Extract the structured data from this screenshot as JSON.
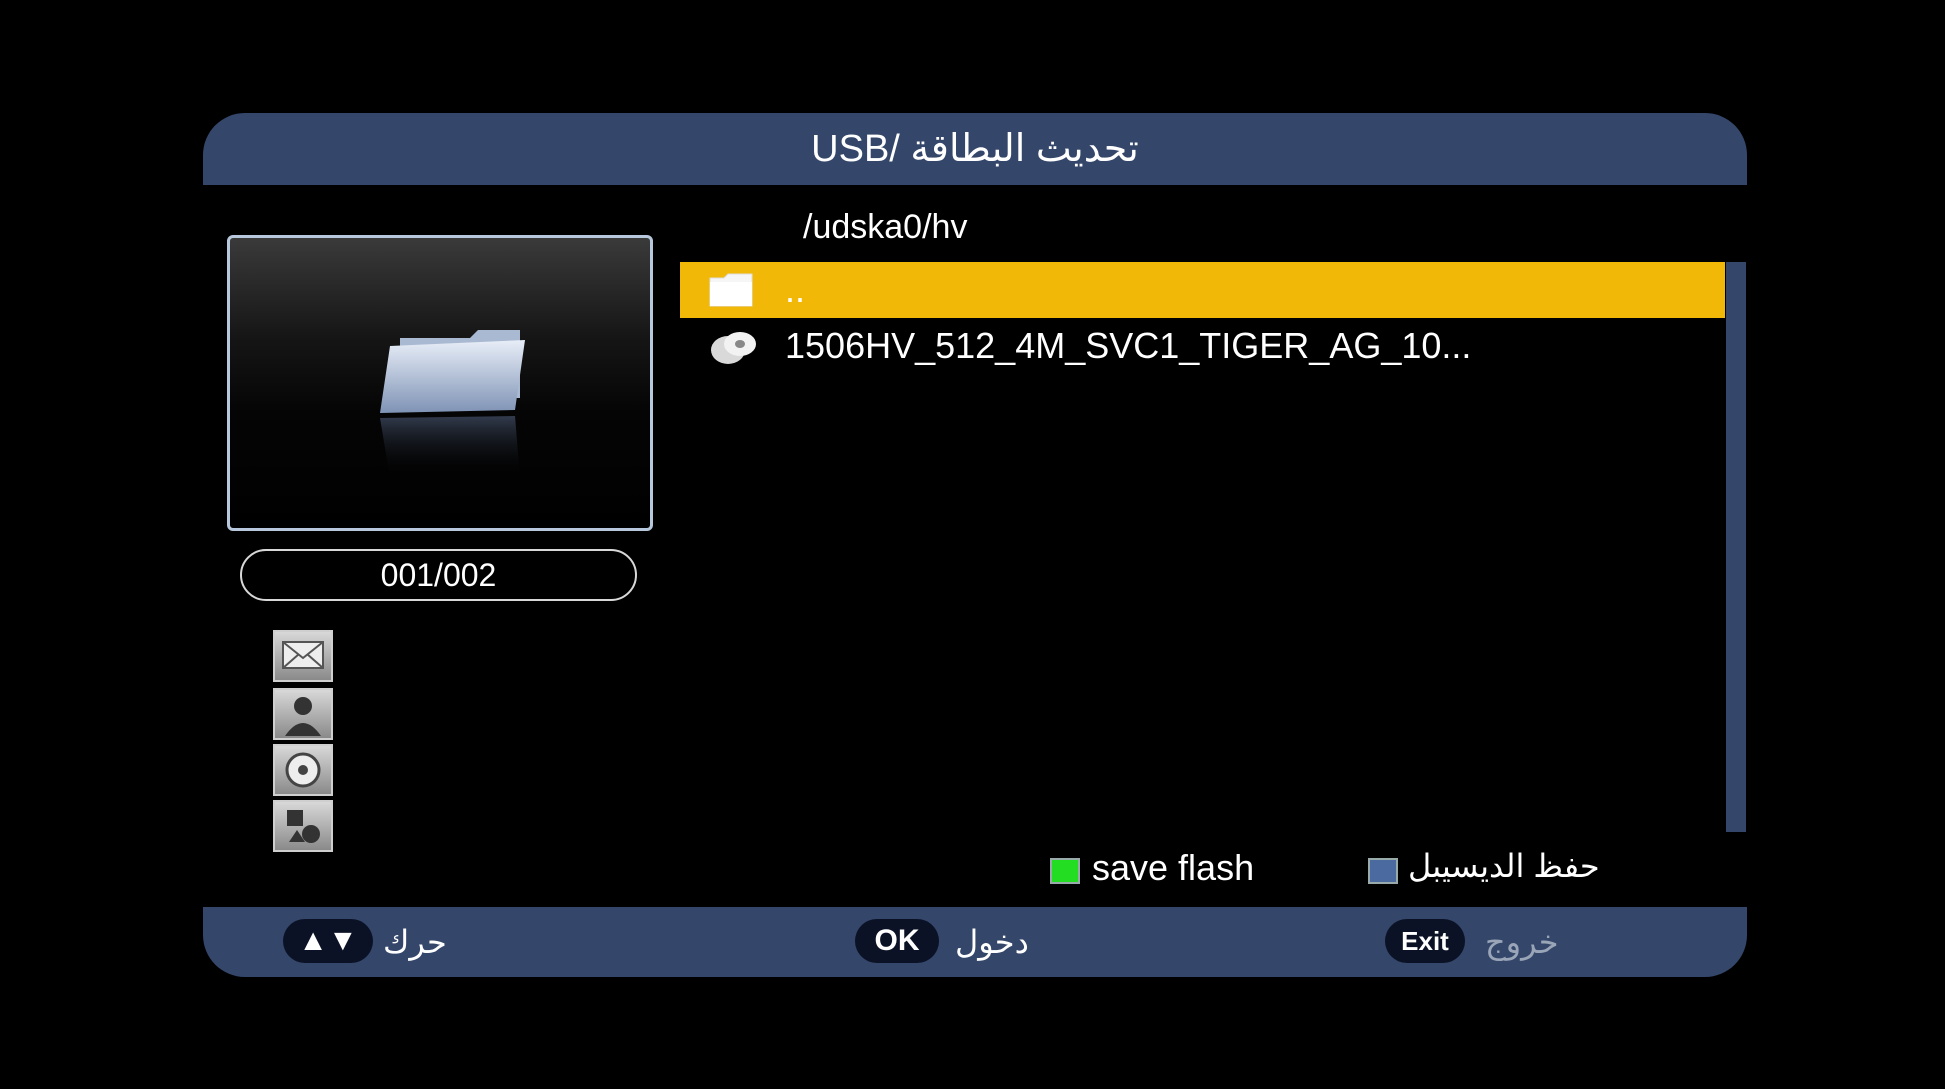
{
  "header": {
    "title": "USB/  تحديث البطاقة"
  },
  "preview": {
    "counter": "001/002"
  },
  "file_browser": {
    "path": "/udska0/hv",
    "items": [
      {
        "label": "..",
        "icon": "folder-icon",
        "selected": true
      },
      {
        "label": "1506HV_512_4M_SVC1_TIGER_AG_10...",
        "icon": "disc-file-icon",
        "selected": false
      }
    ]
  },
  "color_keys": {
    "green": {
      "label": "save flash",
      "color": "#22dd22"
    },
    "blue": {
      "label": "حفظ الديسيبل",
      "color": "#4a6aa0"
    }
  },
  "footer": {
    "move": {
      "key": "▲▼",
      "label": "حرك"
    },
    "ok": {
      "key": "OK",
      "label": "دخول"
    },
    "exit": {
      "key": "Exit",
      "label": "خروج"
    }
  },
  "colors": {
    "panel": "#34466a",
    "selection": "#f2b808",
    "background": "#000000"
  }
}
